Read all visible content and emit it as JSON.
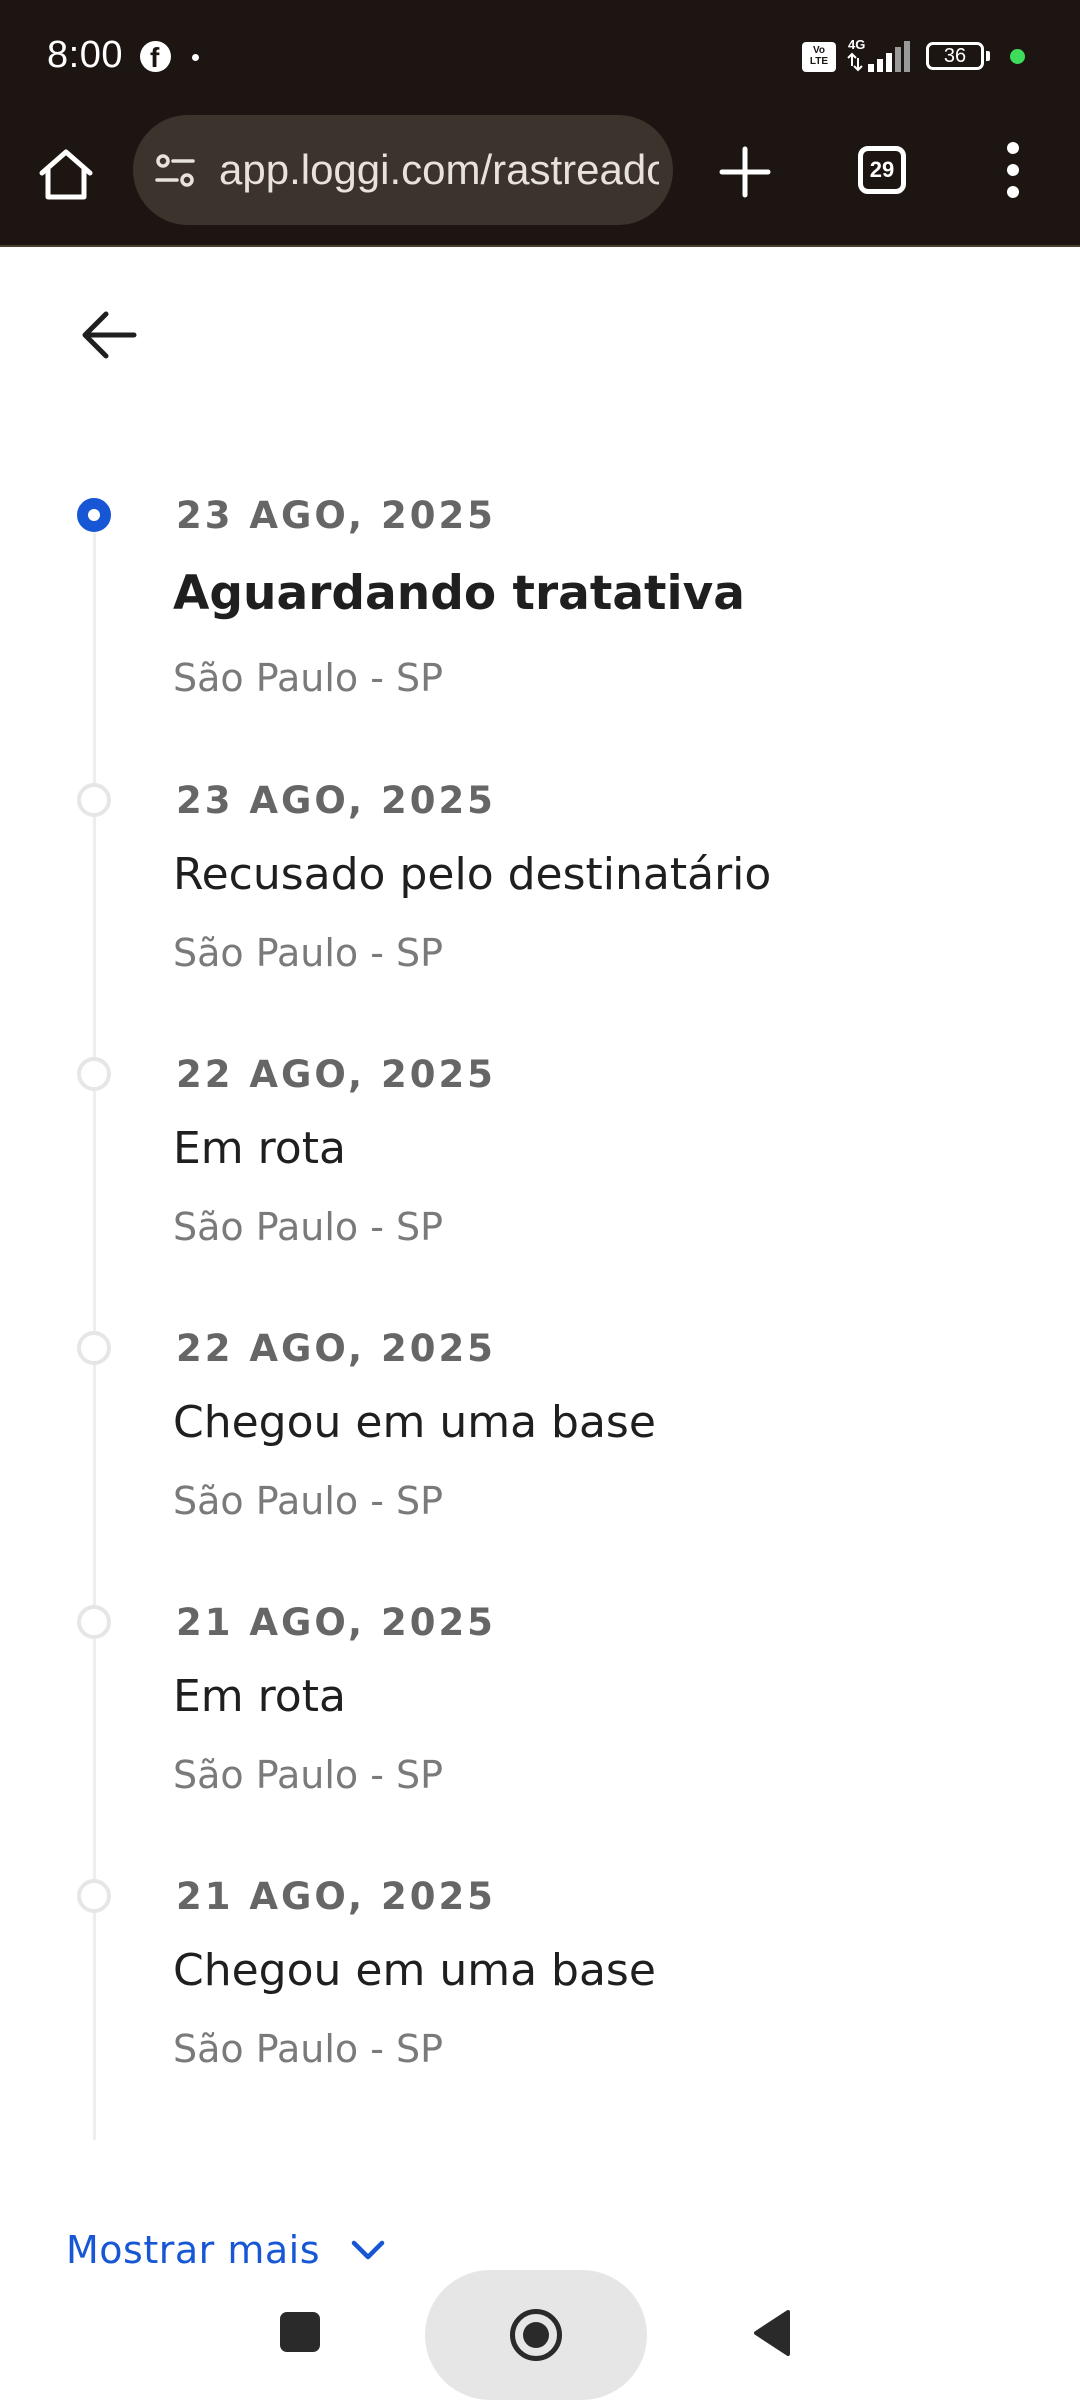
{
  "status_bar": {
    "time": "8:00",
    "network_type": "4G",
    "volte_label": "VoLTE",
    "battery_level": "36",
    "notification_icons": [
      "facebook-icon",
      "dot-icon"
    ]
  },
  "browser": {
    "url": "app.loggi.com/rastreador",
    "tab_count": "29"
  },
  "timeline": {
    "events": [
      {
        "date": "23 AGO, 2025",
        "title": "Aguardando tratativa",
        "location": "São Paulo - SP",
        "active": true
      },
      {
        "date": "23 AGO, 2025",
        "title": "Recusado pelo destinatário",
        "location": "São Paulo - SP",
        "active": false
      },
      {
        "date": "22 AGO, 2025",
        "title": "Em rota",
        "location": "São Paulo - SP",
        "active": false
      },
      {
        "date": "22 AGO, 2025",
        "title": "Chegou em uma base",
        "location": "São Paulo - SP",
        "active": false
      },
      {
        "date": "21 AGO, 2025",
        "title": "Em rota",
        "location": "São Paulo - SP",
        "active": false
      },
      {
        "date": "21 AGO, 2025",
        "title": "Chegou em uma base",
        "location": "São Paulo - SP",
        "active": false
      }
    ]
  },
  "show_more": {
    "label": "Mostrar mais"
  },
  "colors": {
    "accent": "#1757d6",
    "browser_bar": "#1d1512",
    "url_box": "#3c332c",
    "date_text": "#666666",
    "location_text": "#7a7a7a",
    "battery_indicator": "#3ddc5a"
  }
}
